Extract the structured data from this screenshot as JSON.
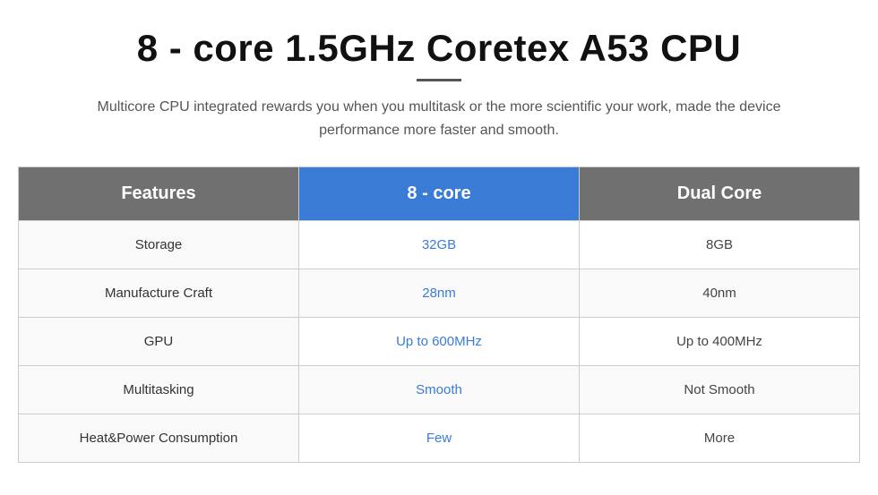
{
  "header": {
    "title": "8 - core 1.5GHz Coretex A53 CPU",
    "subtitle": "Multicore CPU integrated rewards you when you multitask or the more scientific your work, made the device performance more faster and smooth."
  },
  "table": {
    "columns": {
      "features": "Features",
      "core8": "8 - core",
      "dual": "Dual Core"
    },
    "rows": [
      {
        "label": "Storage",
        "core8_value": "32GB",
        "dual_value": "8GB"
      },
      {
        "label": "Manufacture Craft",
        "core8_value": "28nm",
        "dual_value": "40nm"
      },
      {
        "label": "GPU",
        "core8_value": "Up to 600MHz",
        "dual_value": "Up to 400MHz"
      },
      {
        "label": "Multitasking",
        "core8_value": "Smooth",
        "dual_value": "Not Smooth"
      },
      {
        "label": "Heat&Power Consumption",
        "core8_value": "Few",
        "dual_value": "More"
      }
    ]
  }
}
